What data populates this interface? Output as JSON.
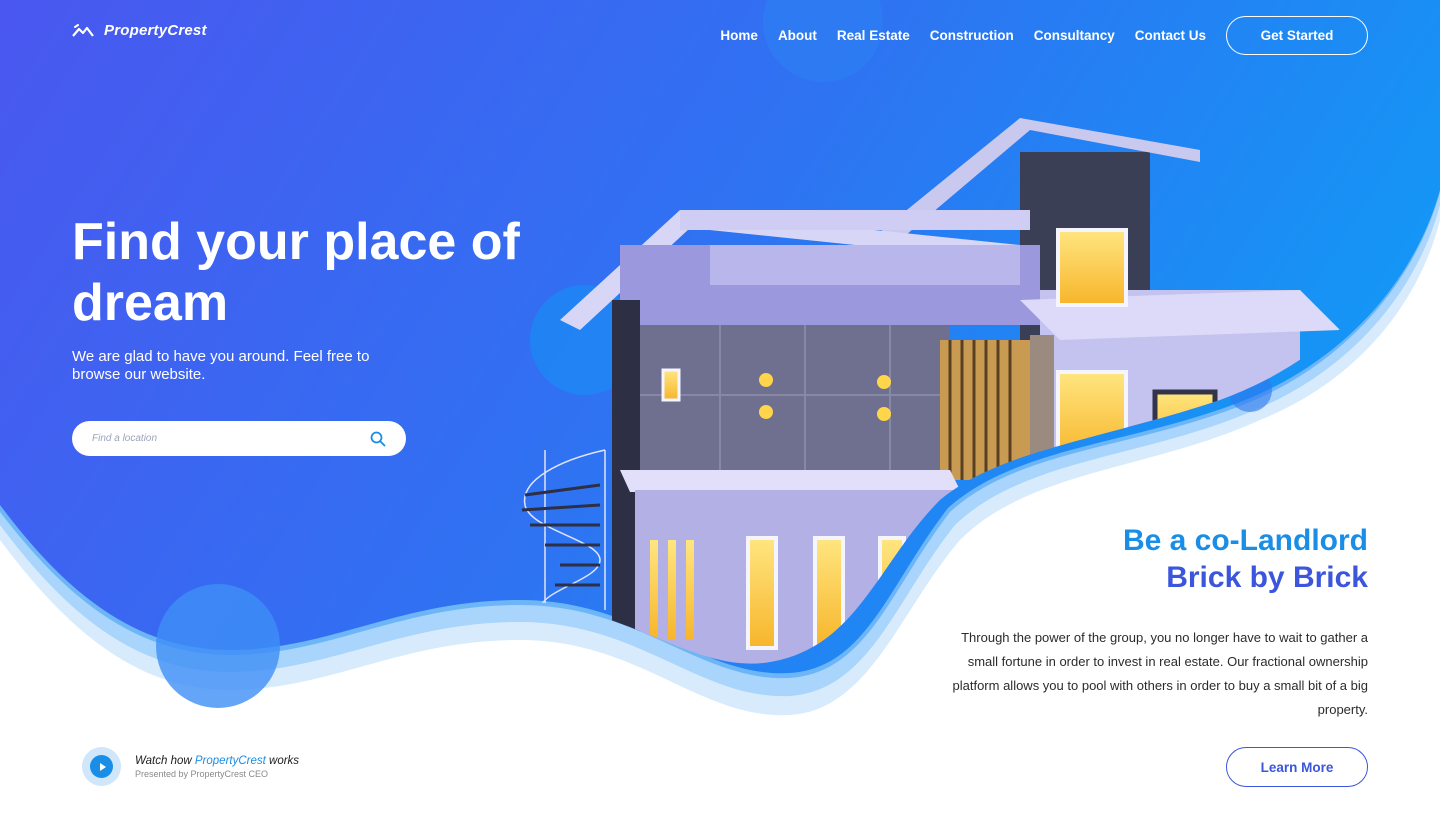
{
  "brand": {
    "name": "PropertyCrest",
    "logo_icon": "mountain-logo-icon"
  },
  "nav": {
    "links": [
      "Home",
      "About",
      "Real Estate",
      "Construction",
      "Consultancy",
      "Contact Us"
    ],
    "cta_label": "Get Started"
  },
  "hero": {
    "title": "Find your place of dream",
    "subtitle": "We are glad to have you around. Feel free to browse our website.",
    "search": {
      "placeholder": "Find a location",
      "icon": "search-icon"
    }
  },
  "promo": {
    "title_line1": "Be a co-Landlord",
    "title_line2": "Brick by Brick",
    "body": "Through the power of the group, you no longer have to wait to gather a small fortune in order to invest in real estate. Our fractional ownership platform allows you to pool with others in order to buy a small bit of a big property.",
    "button_label": "Learn More"
  },
  "watch": {
    "prefix": "Watch how",
    "brand": "PropertyCrest",
    "suffix": "works",
    "subtitle": "Presented by PropertyCrest CEO",
    "icon": "play-icon"
  },
  "colors": {
    "hero_gradient_start": "#4a57f0",
    "hero_gradient_end": "#1a8ef5",
    "accent_blue": "#1a8ee6",
    "accent_indigo": "#3b55dd",
    "wave_light": "#cfe6fb"
  }
}
